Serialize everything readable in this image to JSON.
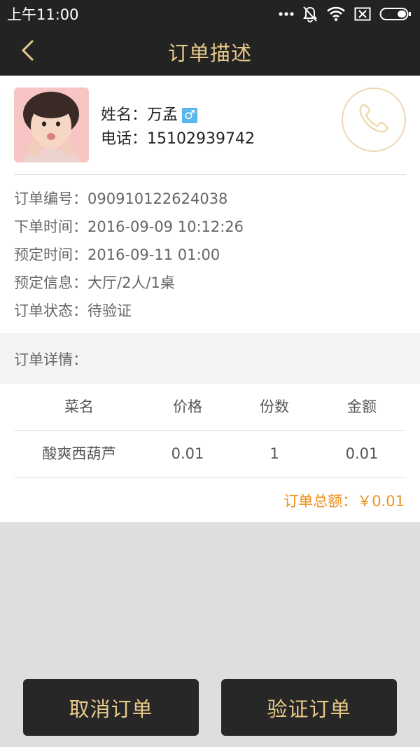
{
  "status_bar": {
    "time": "上午11:00",
    "icons": [
      "more-dots-icon",
      "mute-bell-icon",
      "wifi-icon",
      "sim-off-icon",
      "battery-icon"
    ]
  },
  "header": {
    "title": "订单描述",
    "back_icon": "chevron-left-icon"
  },
  "customer": {
    "name_label": "姓名：",
    "name": "万孟",
    "gender_symbol": "♂",
    "phone_label": "电话：",
    "phone": "15102939742",
    "call_icon": "phone-icon"
  },
  "order": {
    "number_label": "订单编号：",
    "number": "090910122624038",
    "created_label": "下单时间：",
    "created": "2016-09-09 10:12:26",
    "reserved_label": "预定时间：",
    "reserved": "2016-09-11 01:00",
    "info_label": "预定信息：",
    "info": "大厅/2人/1桌",
    "status_label": "订单状态：",
    "status": "待验证"
  },
  "details": {
    "section_title": "订单详情：",
    "columns": [
      "菜名",
      "价格",
      "份数",
      "金额"
    ],
    "rows": [
      [
        "酸爽西葫芦",
        "0.01",
        "1",
        "0.01"
      ]
    ],
    "total_label": "订单总额：",
    "total_value": "￥0.01"
  },
  "actions": {
    "cancel_label": "取消订单",
    "verify_label": "验证订单"
  },
  "colors": {
    "dark_bar": "#232323",
    "accent_gold": "#e8c98a",
    "total_orange": "#f0901f",
    "gender_blue": "#5ab7ec"
  }
}
